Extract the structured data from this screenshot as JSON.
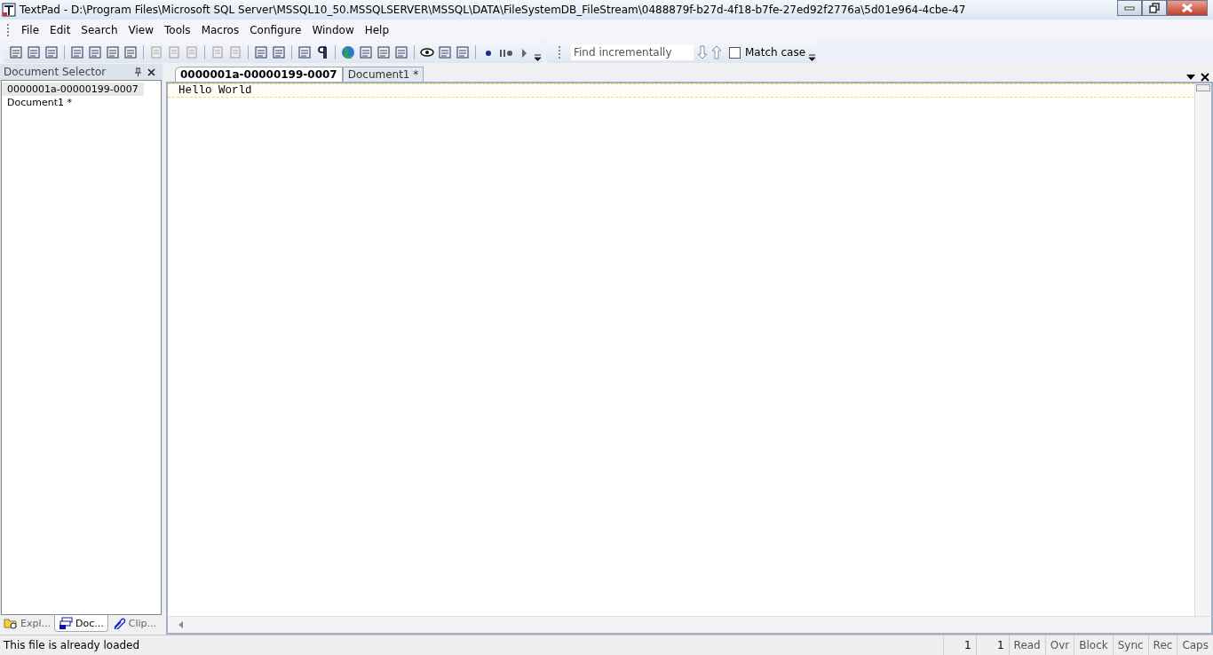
{
  "window": {
    "title": "TextPad - D:\\Program Files\\Microsoft SQL Server\\MSSQL10_50.MSSQLSERVER\\MSSQL\\DATA\\FileSystemDB_FileStream\\0488879f-b27d-4f18-b7fe-27ed92f2776a\\5d01e964-4cbe-47"
  },
  "menu": [
    "File",
    "Edit",
    "Search",
    "View",
    "Tools",
    "Macros",
    "Configure",
    "Window",
    "Help"
  ],
  "find_toolbar": {
    "placeholder": "Find incrementally",
    "match_case": {
      "label": "Match case",
      "checked": false
    }
  },
  "document_selector": {
    "title": "Document Selector",
    "items": [
      {
        "label": "0000001a-00000199-0007",
        "selected": true
      },
      {
        "label": "Document1 *",
        "selected": false
      }
    ]
  },
  "panel_tabs": [
    {
      "label": "Expl...",
      "selected": false
    },
    {
      "label": "Doc...",
      "selected": true
    },
    {
      "label": "Clip...",
      "selected": false
    }
  ],
  "editor_tabs": [
    {
      "label": "0000001a-00000199-0007",
      "selected": true
    },
    {
      "label": "Document1 *",
      "selected": false
    }
  ],
  "editor": {
    "lines": [
      "Hello World"
    ]
  },
  "status_bar": {
    "message": "This file is already loaded",
    "panes": [
      "1",
      "1",
      "Read",
      "Ovr",
      "Block",
      "Sync",
      "Rec",
      "Caps"
    ]
  }
}
